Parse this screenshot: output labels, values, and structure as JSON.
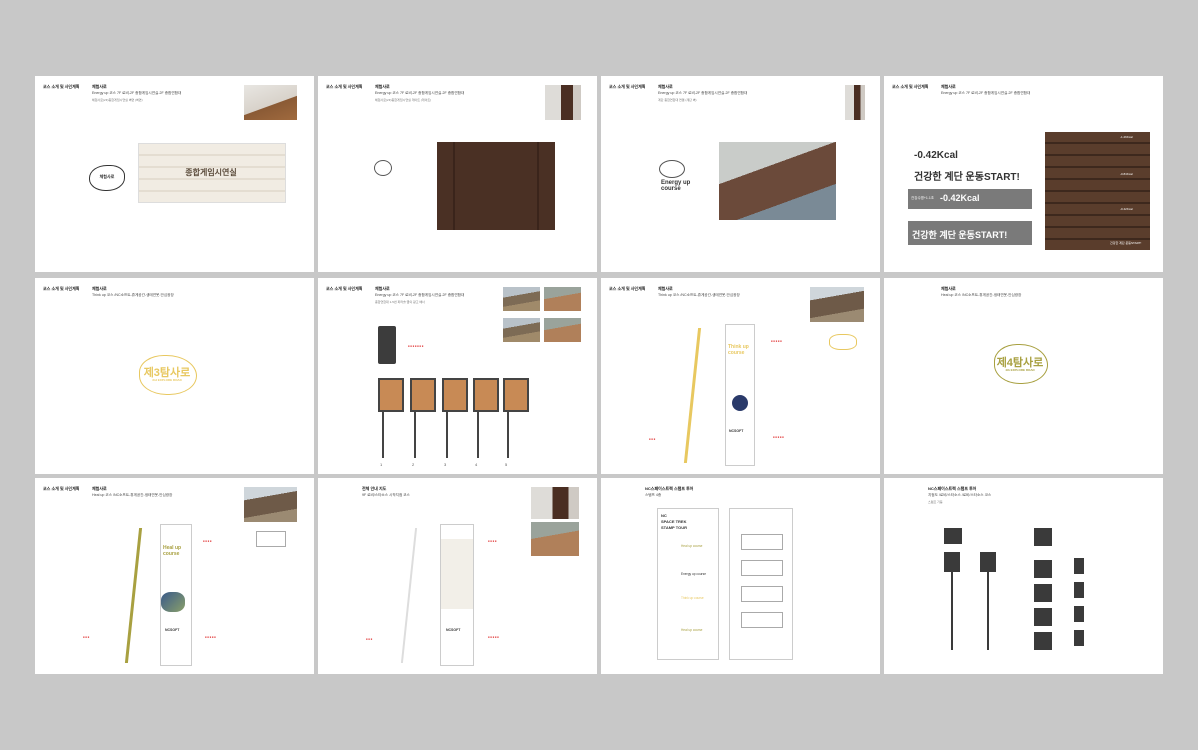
{
  "page": {
    "background": "#c8c8c8"
  },
  "colors": {
    "accent_red": "#e03030",
    "wood": "#4a3024",
    "yellow_logo": "#e8c860",
    "olive_logo": "#a8a040"
  },
  "slides": [
    {
      "section": "코스 소개 및 사인계획",
      "title": "체험사로",
      "subtitle": "Energy up 코스 7F 로비-2F 종합게임시연실-2F 종합연합대",
      "note": "체험사로(2F)종합게임시연실 벽면 (벽면)",
      "sign_text": "종합게임시연실",
      "logo_text": "체험사로"
    },
    {
      "section": "코스 소개 및 사인계획",
      "title": "체험사로",
      "subtitle": "Energy up 코스 7F 로비-2F 종합게임시연실-2F 종합연합대",
      "note": "체험사로(2F)종합게임시연실 게이트 (게이트)"
    },
    {
      "section": "코스 소개 및 사인계획",
      "title": "체험사로",
      "subtitle": "Energy up 코스 7F 로비-2F 종합게임시연실-2F 종합연합대",
      "note": "계단 종합연합대 연결 (계단 벽)",
      "logo_line1": "Energy up",
      "logo_line2": "course"
    },
    {
      "section": "코스 소개 및 사인계획",
      "title": "체험사로",
      "subtitle": "Energy up 코스 7F 로비-2F 종합게임시연실-2F 종합연합대",
      "kcal_big": "-0.42Kcal",
      "start_big": "건강한 계단 운동START!",
      "bar1_label": "건강수명+1.1초",
      "bar1_kcal": "-0.42Kcal",
      "bar2_text": "건강한 계단 운동START!",
      "stairs": [
        "-1.26Kcal",
        "-0.84Kcal",
        "-0.42Kcal",
        "건강한 계단 운동START!"
      ]
    },
    {
      "section": "코스 소개 및 사인계획",
      "title": "체험사로",
      "subtitle": "Think up 코스 /NC소프트-휴게공간-생태연못-안심광장",
      "logo_main": "제3탐사로",
      "logo_sub": "3rd EXPLORE ROAD"
    },
    {
      "section": "코스 소개 및 사인계획",
      "title": "체험사로",
      "subtitle": "Energy up 코스 7F 로비-2F 종합게임시연실-2F 종합연합대",
      "note": "종합연합대 1-5번 파라솔 옆의 광고 배너",
      "stand_numbers": [
        "1",
        "2",
        "3",
        "4",
        "5"
      ]
    },
    {
      "section": "코스 소개 및 사인계획",
      "title": "체험사로",
      "subtitle": "Think up 코스 /NC소프트-휴게공간-생태연못-안심광장",
      "sign_title": "Think up",
      "sign_sub": "course",
      "brand": "NCSOFT"
    },
    {
      "section": "",
      "title": "체험사로",
      "subtitle": "Heal up 코스 /NC소프트-휴게공간-생태연못-안심광장",
      "logo_main": "제4탐사로",
      "logo_sub": "4th EXPLORE ROAD"
    },
    {
      "section": "코스 소개 및 사인계획",
      "title": "체험사로",
      "subtitle": "Heal up 코스 /NC소프트-휴게공간-생태연못-안심광장",
      "sign_title": "Heal up",
      "sign_sub": "course",
      "brand": "NCSOFT"
    },
    {
      "section": "",
      "title": "전체 안내 지도",
      "subtitle": "9F 로비/스타소스 시작지점 코스",
      "brand": "NCSOFT"
    },
    {
      "section": "",
      "title": "NC스페이스트렉 스탬프 투어",
      "subtitle": "스탬프 4종",
      "card_title1": "NC",
      "card_title2": "SPACE TREK",
      "card_title3": "STAMP TOUR",
      "courses": [
        "Heal up course",
        "Energy up course",
        "Think up course",
        "Heal up course"
      ]
    },
    {
      "section": "",
      "title": "NC스페이스트렉 스탬프 투어",
      "subtitle": "지점도 /로비/스타소스 /로비/스타소스 코스",
      "note": "스탬프 기둥"
    }
  ]
}
